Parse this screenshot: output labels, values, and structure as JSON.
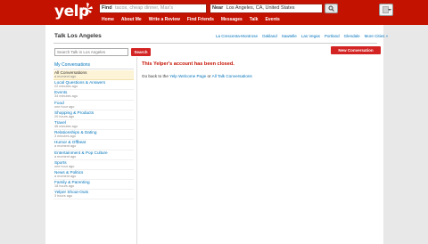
{
  "header": {
    "logo_text": "yelp",
    "find_label": "Find",
    "find_placeholder": "tacos, cheap dinner, Max's",
    "near_label": "Near",
    "near_value": "Los Angeles, CA, United States",
    "nav": [
      "Home",
      "About Me",
      "Write a Review",
      "Find Friends",
      "Messages",
      "Talk",
      "Events"
    ]
  },
  "page": {
    "title": "Talk Los Angeles",
    "city_links": [
      "La Crescenta-Montrose",
      "Oakland",
      "Sawtelle",
      "Las Vegas",
      "Portland",
      "Glendale",
      "More Cities »"
    ],
    "search_placeholder": "Search Talk in Los Angeles",
    "search_button": "Search",
    "new_conversation_button": "New Conversation"
  },
  "sidebar": {
    "heading": "My Conversations",
    "items": [
      {
        "label": "All Conversations",
        "time": "a moment ago"
      },
      {
        "label": "Local Questions & Answers",
        "time": "22 minutes ago"
      },
      {
        "label": "Events",
        "time": "34 minutes ago"
      },
      {
        "label": "Food",
        "time": "one hour ago"
      },
      {
        "label": "Shopping & Products",
        "time": "20 hours ago"
      },
      {
        "label": "Travel",
        "time": "46 minutes ago"
      },
      {
        "label": "Relationships & Dating",
        "time": "3 minutes ago"
      },
      {
        "label": "Humor & Offbeat",
        "time": "a moment ago"
      },
      {
        "label": "Entertainment & Pop Culture",
        "time": "a moment ago"
      },
      {
        "label": "Sports",
        "time": "one hour ago"
      },
      {
        "label": "News & Politics",
        "time": "a moment ago"
      },
      {
        "label": "Family & Parenting",
        "time": "18 hours ago"
      },
      {
        "label": "Yelper Shout-Outs",
        "time": "3 hours ago"
      }
    ]
  },
  "main": {
    "closed_message": "This Yelper's account has been closed.",
    "go_back_prefix": "Go back to the",
    "welcome_link": "Yelp Welcome Page",
    "or_text": "or",
    "all_talk_link": "All Talk Conversations"
  },
  "colors": {
    "brand_red": "#c41200",
    "button_red": "#d32323",
    "link_blue": "#0073bb",
    "active_item_bg": "#fdf3d6"
  }
}
